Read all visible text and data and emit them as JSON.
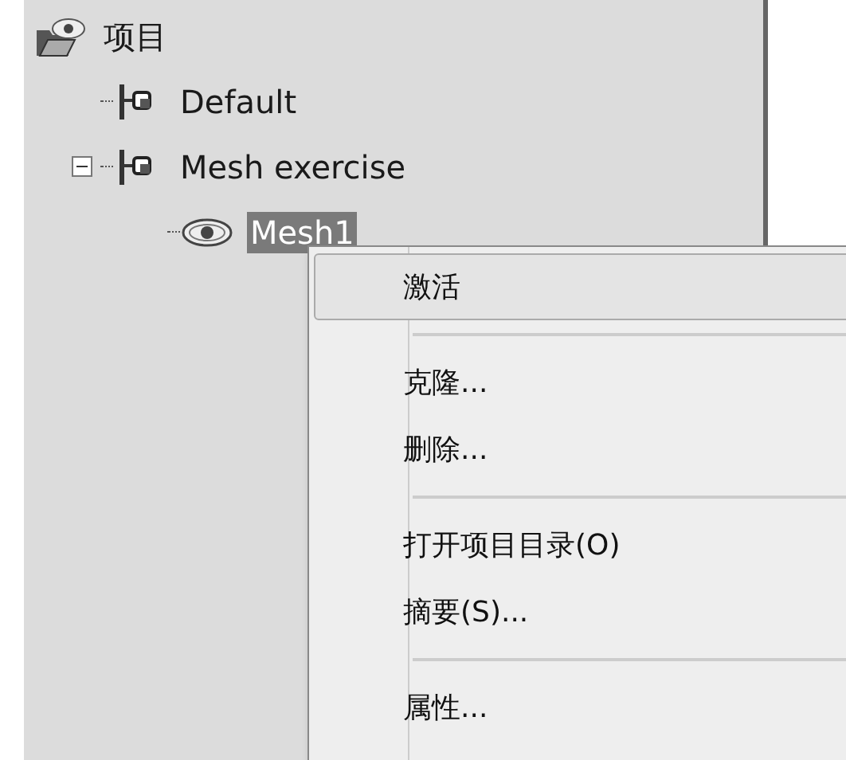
{
  "tree": [
    {
      "label": "项目",
      "kind": "project",
      "selected": false,
      "children": [
        {
          "label": "Default",
          "kind": "case",
          "selected": false
        },
        {
          "label": "Mesh exercise",
          "kind": "case",
          "selected": false,
          "expanded": true,
          "children": [
            {
              "label": "Mesh1",
              "kind": "mesh",
              "selected": true
            }
          ]
        }
      ]
    }
  ],
  "context_menu": [
    {
      "kind": "item",
      "label": "激活",
      "highlighted": true
    },
    {
      "kind": "separator"
    },
    {
      "kind": "item",
      "label": "克隆...",
      "highlighted": false
    },
    {
      "kind": "item",
      "label": "删除...",
      "highlighted": false
    },
    {
      "kind": "separator"
    },
    {
      "kind": "item",
      "label": "打开项目目录(O)",
      "highlighted": false
    },
    {
      "kind": "item",
      "label": "摘要(S)...",
      "highlighted": false
    },
    {
      "kind": "separator"
    },
    {
      "kind": "item",
      "label": "属性...",
      "highlighted": false
    }
  ]
}
